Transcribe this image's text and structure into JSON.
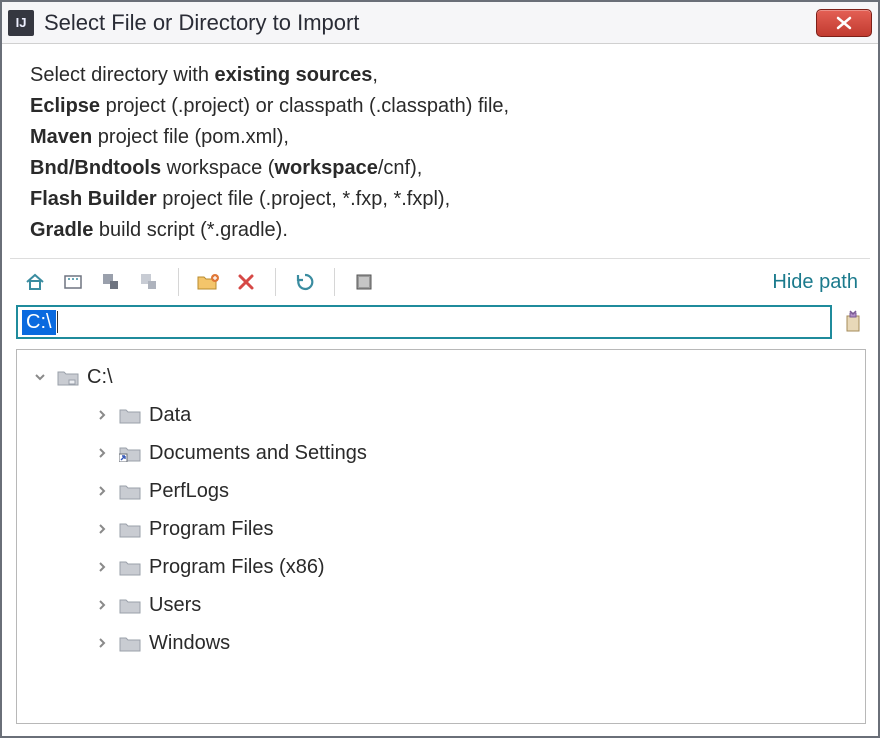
{
  "window": {
    "title": "Select File or Directory to Import",
    "app_icon_text": "IJ"
  },
  "instructions": {
    "line1_prefix": "Select directory with ",
    "line1_bold": "existing sources",
    "line1_suffix": ",",
    "line2_bold": "Eclipse",
    "line2_rest": " project (.project) or classpath (.classpath) file,",
    "line3_bold": "Maven",
    "line3_rest": " project file (pom.xml),",
    "line4_bold1": "Bnd/Bndtools",
    "line4_mid": " workspace (",
    "line4_bold2": "workspace",
    "line4_rest": "/cnf),",
    "line5_bold": "Flash Builder",
    "line5_rest": " project file (.project, *.fxp, *.fxpl),",
    "line6_bold": "Gradle",
    "line6_rest": " build script (*.gradle)."
  },
  "toolbar": {
    "hide_path_label": "Hide path"
  },
  "path": {
    "value": "C:\\"
  },
  "tree": {
    "root": {
      "label": "C:\\",
      "expanded": true
    },
    "children": [
      {
        "label": "Data",
        "shortcut": false
      },
      {
        "label": "Documents and Settings",
        "shortcut": true
      },
      {
        "label": "PerfLogs",
        "shortcut": false
      },
      {
        "label": "Program Files",
        "shortcut": false
      },
      {
        "label": "Program Files (x86)",
        "shortcut": false
      },
      {
        "label": "Users",
        "shortcut": false
      },
      {
        "label": "Windows",
        "shortcut": false
      }
    ]
  }
}
